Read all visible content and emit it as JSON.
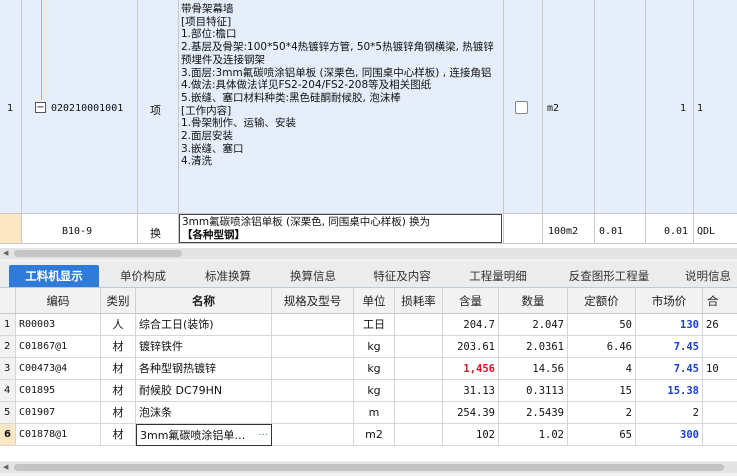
{
  "top_grid": {
    "rows": [
      {
        "index": "1",
        "code": "020210001001",
        "type": "项",
        "description_lines": [
          "带骨架幕墙",
          "[项目特征]",
          "1.部位:檐口",
          "2.基层及骨架:100*50*4热镀锌方管, 50*5热镀锌角钢横梁, 热镀锌预埋件及连接钢架",
          "3.面层:3mm氟碳喷涂铝单板 (深栗色, 同围桌中心样板) , 连接角铝",
          "4.做法:具体做法详见FS2-204/FS2-208等及相关图纸",
          "5.嵌缝、塞口材料种类:黑色硅酮耐候胶, 泡沫棒",
          "[工作内容]",
          "1.骨架制作、运输、安装",
          "2.面层安装",
          "3.嵌缝、塞口",
          "4.清洗"
        ],
        "unit": "m2",
        "quantity": "1",
        "quantity2": "1"
      },
      {
        "index": "",
        "code": "B10-9",
        "type": "换",
        "description_lines": [
          "3mm氟碳喷涂铝单板 (深栗色, 同围桌中心样板)   换为",
          "【各种型钢】"
        ],
        "unit": "100m2",
        "quantity": "0.01",
        "quantity2": "0.01",
        "extra": "QDL"
      }
    ]
  },
  "tabs": [
    "工料机显示",
    "单价构成",
    "标准换算",
    "换算信息",
    "特征及内容",
    "工程量明细",
    "反查图形工程量",
    "说明信息"
  ],
  "active_tab": 0,
  "bottom_table": {
    "headers": [
      "编码",
      "类别",
      "名称",
      "规格及型号",
      "单位",
      "损耗率",
      "含量",
      "数量",
      "定额价",
      "市场价",
      "合"
    ],
    "rows": [
      {
        "idx": "1",
        "code": "R00003",
        "cat": "人",
        "name": "综合工日(装饰)",
        "spec": "",
        "unit": "工日",
        "loss": "",
        "content": "204.7",
        "qty": "2.047",
        "base": "50",
        "market": "130",
        "total": "26"
      },
      {
        "idx": "2",
        "code": "C01867@1",
        "cat": "材",
        "name": "镀锌铁件",
        "spec": "",
        "unit": "kg",
        "loss": "",
        "content": "203.61",
        "qty": "2.0361",
        "base": "6.46",
        "market": "7.45",
        "total": ""
      },
      {
        "idx": "3",
        "code": "C00473@4",
        "cat": "材",
        "name": "各种型钢热镀锌",
        "spec": "",
        "unit": "kg",
        "loss": "",
        "content": "1,456",
        "qty": "14.56",
        "base": "4",
        "market": "7.45",
        "total": "10"
      },
      {
        "idx": "4",
        "code": "C01895",
        "cat": "材",
        "name": "耐候胶 DC79HN",
        "spec": "",
        "unit": "kg",
        "loss": "",
        "content": "31.13",
        "qty": "0.3113",
        "base": "15",
        "market": "15.38",
        "total": ""
      },
      {
        "idx": "5",
        "code": "C01907",
        "cat": "材",
        "name": "泡沫条",
        "spec": "",
        "unit": "m",
        "loss": "",
        "content": "254.39",
        "qty": "2.5439",
        "base": "2",
        "market": "2",
        "total": ""
      },
      {
        "idx": "6",
        "code": "C01878@1",
        "cat": "材",
        "name": "3mm氟碳喷涂铝单…",
        "spec": "",
        "unit": "m2",
        "loss": "",
        "content": "102",
        "qty": "1.02",
        "base": "65",
        "market": "300",
        "total": ""
      }
    ]
  },
  "colors": {
    "tab_active": "#2f7bd8",
    "row_highlight": "#e6eefb",
    "market_price": "#1a3fd6",
    "content_red": "#e0102a"
  }
}
